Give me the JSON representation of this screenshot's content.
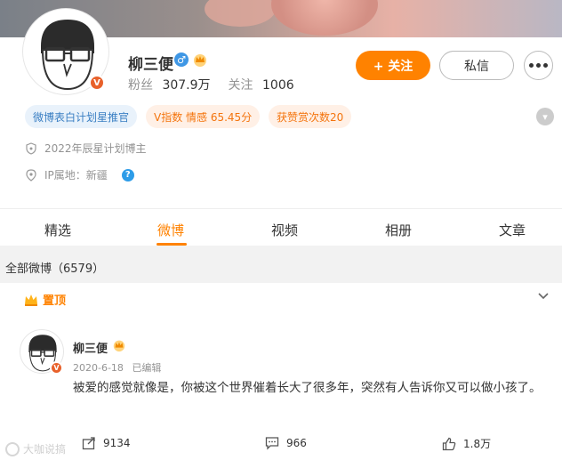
{
  "profile": {
    "name": "柳三便",
    "gender_icon": "male-icon",
    "verified_badge": "V",
    "followers_label": "粉丝",
    "followers_count": "307.9万",
    "following_label": "关注",
    "following_count": "1006",
    "follow_button": "+ 关注",
    "message_button": "私信",
    "tags": [
      "微博表白计划星推官",
      "V指数 情感 65.45分",
      "获赞赏次数20"
    ],
    "info": {
      "badge_text": "2022年辰星计划博主",
      "ip_label": "IP属地：新疆"
    }
  },
  "tabs": [
    {
      "label": "精选"
    },
    {
      "label": "微博"
    },
    {
      "label": "视频"
    },
    {
      "label": "相册"
    },
    {
      "label": "文章"
    }
  ],
  "active_tab": "微博",
  "all_posts_label": "全部微博（6579）",
  "post": {
    "pinned_label": "置顶",
    "author": "柳三便",
    "date": "2020-6-18",
    "edited": "已编辑",
    "text": "被爱的感觉就像是，你被这个世界催着长大了很多年，突然有人告诉你又可以做小孩了。",
    "reposts": "9134",
    "comments": "966",
    "likes": "1.8万"
  },
  "watermark": "大咖说搞",
  "colors": {
    "accent": "#ff8200",
    "link_blue": "#3a7fc3",
    "verified": "#e8612b"
  }
}
